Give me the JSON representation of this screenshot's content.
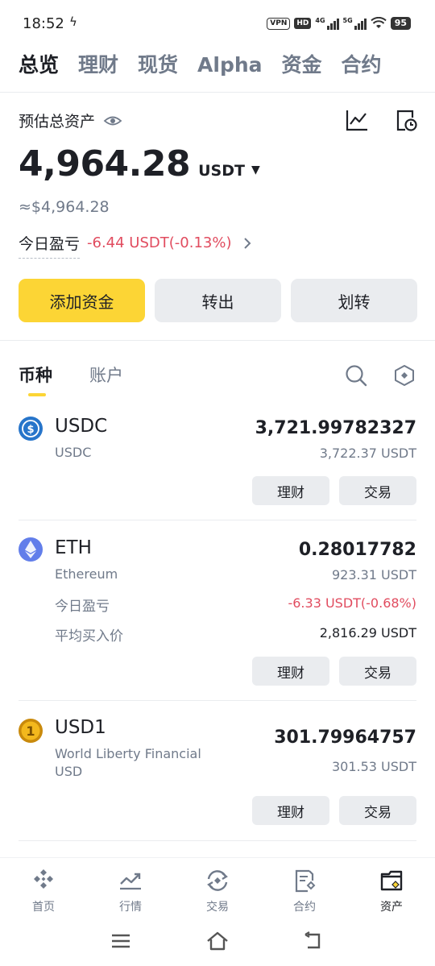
{
  "status_bar": {
    "time": "18:52",
    "vpn": "VPN",
    "hd": "HD",
    "net1": "4G",
    "net2": "5G",
    "battery": "95"
  },
  "top_tabs": [
    {
      "label": "总览",
      "active": true
    },
    {
      "label": "理财"
    },
    {
      "label": "现货"
    },
    {
      "label": "Alpha"
    },
    {
      "label": "资金"
    },
    {
      "label": "合约"
    }
  ],
  "assets": {
    "estimated_label": "预估总资产",
    "balance": "4,964.28",
    "unit": "USDT",
    "fiat": "≈$4,964.28",
    "pnl_label": "今日盈亏",
    "pnl_value": "-6.44 USDT(-0.13%)"
  },
  "actions": {
    "add_funds": "添加资金",
    "withdraw": "转出",
    "transfer": "划转"
  },
  "sub_tabs": [
    {
      "label": "币种",
      "active": true
    },
    {
      "label": "账户"
    }
  ],
  "coins": [
    {
      "symbol": "USDC",
      "name": "USDC",
      "amount": "3,721.99782327",
      "fiat": "3,722.37 USDT",
      "earn": "理财",
      "trade": "交易"
    },
    {
      "symbol": "ETH",
      "name": "Ethereum",
      "amount": "0.28017782",
      "fiat": "923.31 USDT",
      "pnl_label": "今日盈亏",
      "pnl_value": "-6.33 USDT(-0.68%)",
      "avg_label": "平均买入价",
      "avg_value": "2,816.29 USDT",
      "earn": "理财",
      "trade": "交易"
    },
    {
      "symbol": "USD1",
      "name": "World Liberty Financial USD",
      "amount": "301.79964757",
      "fiat": "301.53 USDT",
      "earn": "理财",
      "trade": "交易"
    }
  ],
  "bottom_nav": [
    {
      "label": "首页",
      "icon": "home-icon"
    },
    {
      "label": "行情",
      "icon": "markets-icon"
    },
    {
      "label": "交易",
      "icon": "trade-icon"
    },
    {
      "label": "合约",
      "icon": "futures-icon"
    },
    {
      "label": "资产",
      "icon": "wallet-icon",
      "active": true
    }
  ],
  "colors": {
    "accent": "#fcd535",
    "negative": "#e14c5f",
    "text_primary": "#1e2026",
    "text_secondary": "#707a8a"
  }
}
